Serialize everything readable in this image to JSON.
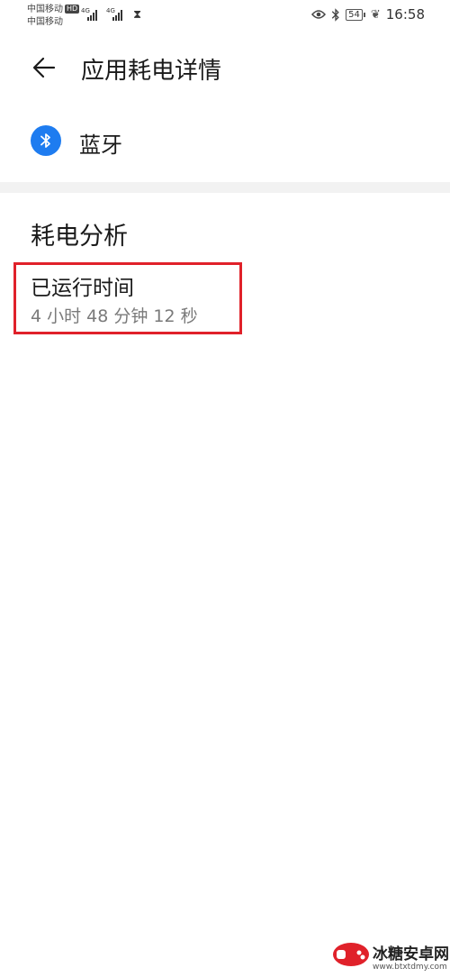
{
  "status_bar": {
    "carrier_1": "中国移动",
    "hd_badge": "HD",
    "carrier_2": "中国移动",
    "network_1": "4G",
    "network_2": "4G",
    "battery_level": "54",
    "time": "16:58",
    "icons": [
      "hourglass-icon",
      "eye-icon",
      "bluetooth-icon",
      "battery-icon",
      "leaf-icon"
    ]
  },
  "header": {
    "title": "应用耗电详情",
    "back_icon": "arrow-left-icon"
  },
  "app": {
    "name": "蓝牙",
    "icon": "bluetooth-icon",
    "icon_color": "#1e7cf0"
  },
  "analysis": {
    "section_title": "耗电分析",
    "runtime_label": "已运行时间",
    "runtime_value": "4 小时 48 分钟 12 秒",
    "highlight_color": "#e0212a"
  },
  "watermark": {
    "name": "冰糖安卓网",
    "url": "www.btxtdmy.com"
  }
}
